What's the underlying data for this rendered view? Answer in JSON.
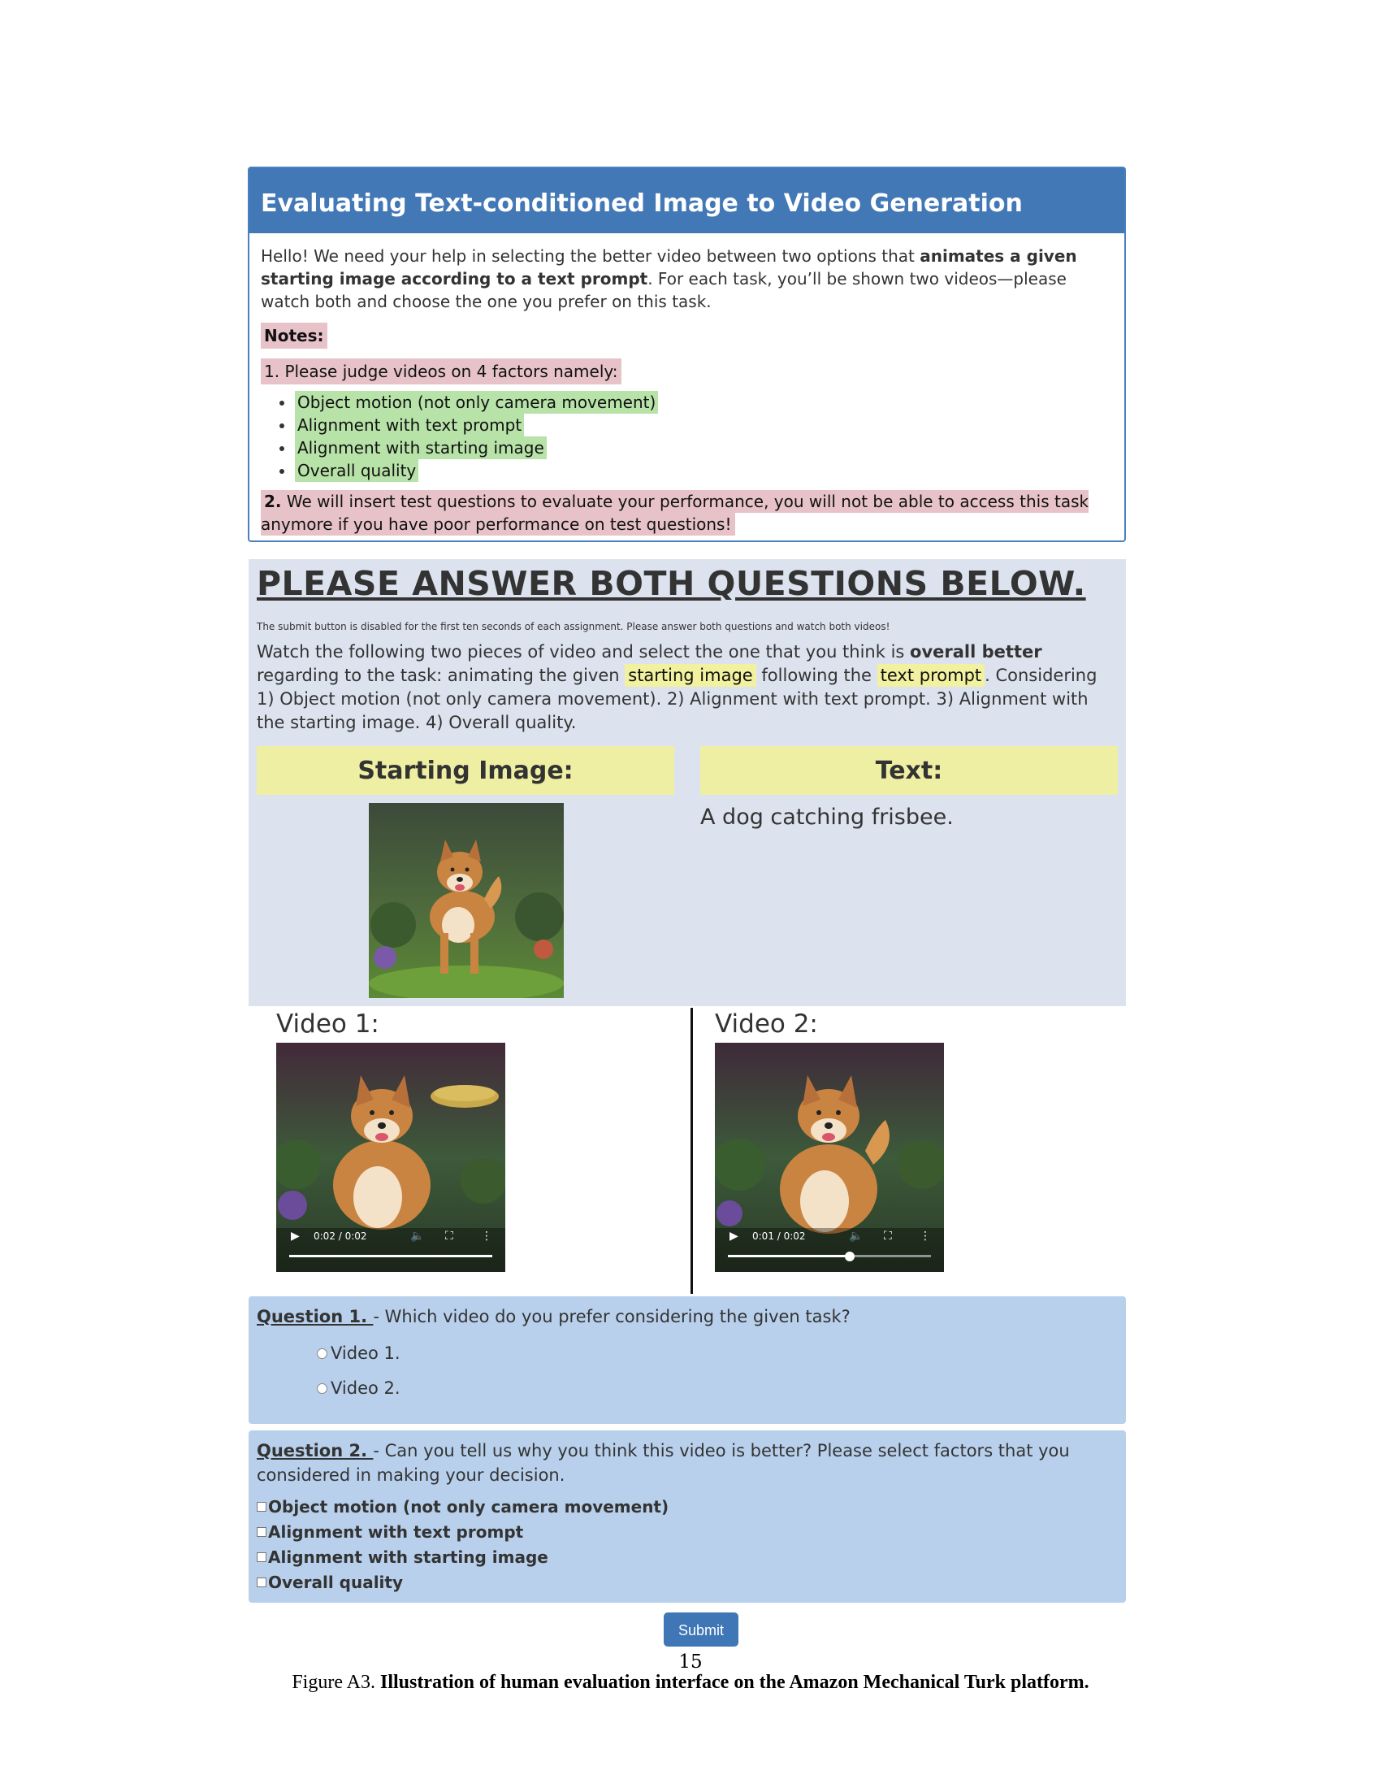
{
  "instructions": {
    "title": "Evaluating Text-conditioned Image to Video Generation",
    "intro_1": "Hello! We need your help in selecting the better video between two options that ",
    "intro_bold": "animates a given starting image according to a text prompt",
    "intro_2": ". For each task, you’ll be shown two videos—please watch both and choose the one you prefer on this task.",
    "notes_label": "Notes:",
    "judge_line": "1. Please judge videos on 4 factors namely:",
    "factors": [
      "Object motion (not only camera movement)",
      "Alignment with text prompt",
      "Alignment with starting image",
      "Overall quality"
    ],
    "warning_num": "2.",
    "warning_text": " We will insert test questions to evaluate your performance, you will not be able to access this task anymore if you have poor performance on test questions!"
  },
  "question_area": {
    "title": "PLEASE ANSWER BOTH QUESTIONS BELOW.",
    "small_note": "The submit button is disabled for the first ten seconds of each assignment. Please answer both questions and watch both videos!",
    "task_1": "Watch the following two pieces of video and select the one that you think is ",
    "task_bold": "overall better",
    "task_2": " regarding to the task: animating the given ",
    "task_hl1": "starting image",
    "task_3": " following the ",
    "task_hl2": "text prompt",
    "task_4": ". Considering 1) Object motion (not only camera movement). 2) Alignment with text prompt. 3) Alignment with the starting image. 4) Overall quality.",
    "starting_image_header": "Starting Image:",
    "text_header": "Text:",
    "prompt": "A dog catching frisbee."
  },
  "videos": [
    {
      "label": "Video 1:",
      "time": "0:02 / 0:02",
      "progress": 1.0
    },
    {
      "label": "Video 2:",
      "time": "0:01 / 0:02",
      "progress": 0.6
    }
  ],
  "question1": {
    "number": "Question 1. ",
    "text": "- Which video do you prefer considering the given task?",
    "options": [
      "Video 1.",
      "Video 2."
    ]
  },
  "question2": {
    "number": "Question 2. ",
    "text": "- Can you tell us why you think this video is better? Please select factors that you considered in making your decision.",
    "options": [
      "Object motion (not only camera movement)",
      "Alignment with text prompt",
      "Alignment with starting image",
      "Overall quality"
    ]
  },
  "submit_label": "Submit",
  "page_number": "15",
  "caption_prefix": "Figure A3. ",
  "caption_bold": "Illustration of human evaluation interface on the Amazon Mechanical Turk platform.",
  "colors": {
    "header_blue": "#4378b6",
    "question_bg": "#b8d0ec",
    "area_bg": "#dce3ee",
    "highlight_yellow": "#efefa3"
  }
}
